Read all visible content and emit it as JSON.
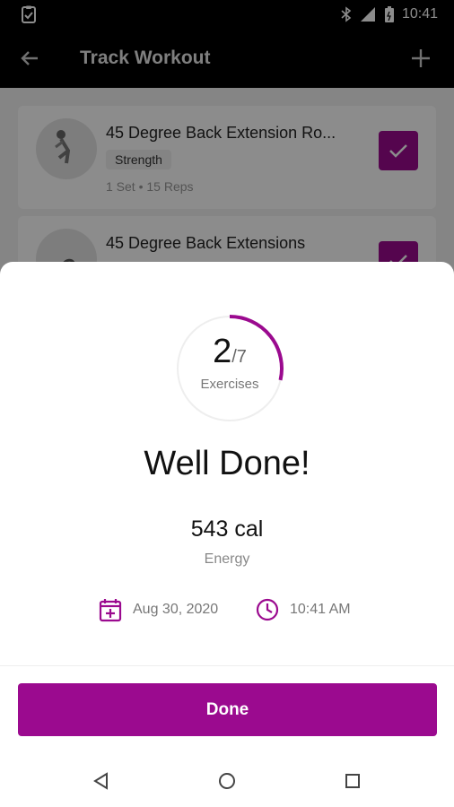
{
  "status_bar": {
    "time": "10:41",
    "network": "4G"
  },
  "app_bar": {
    "title": "Track Workout"
  },
  "exercises": [
    {
      "name": "45 Degree Back Extension Ro...",
      "tag": "Strength",
      "meta": "1 Set • 15 Reps",
      "checked": true
    },
    {
      "name": "45 Degree Back Extensions",
      "tag": "",
      "meta": "",
      "checked": true
    }
  ],
  "summary": {
    "completed": "2",
    "total": "/7",
    "label": "Exercises",
    "progress_fraction": 0.2857,
    "heading": "Well Done!",
    "energy_value": "543 cal",
    "energy_label": "Energy",
    "date": "Aug 30, 2020",
    "time": "10:41 AM",
    "done_label": "Done"
  },
  "colors": {
    "accent": "#9b0a8f",
    "status_bar_bg": "#000000"
  }
}
